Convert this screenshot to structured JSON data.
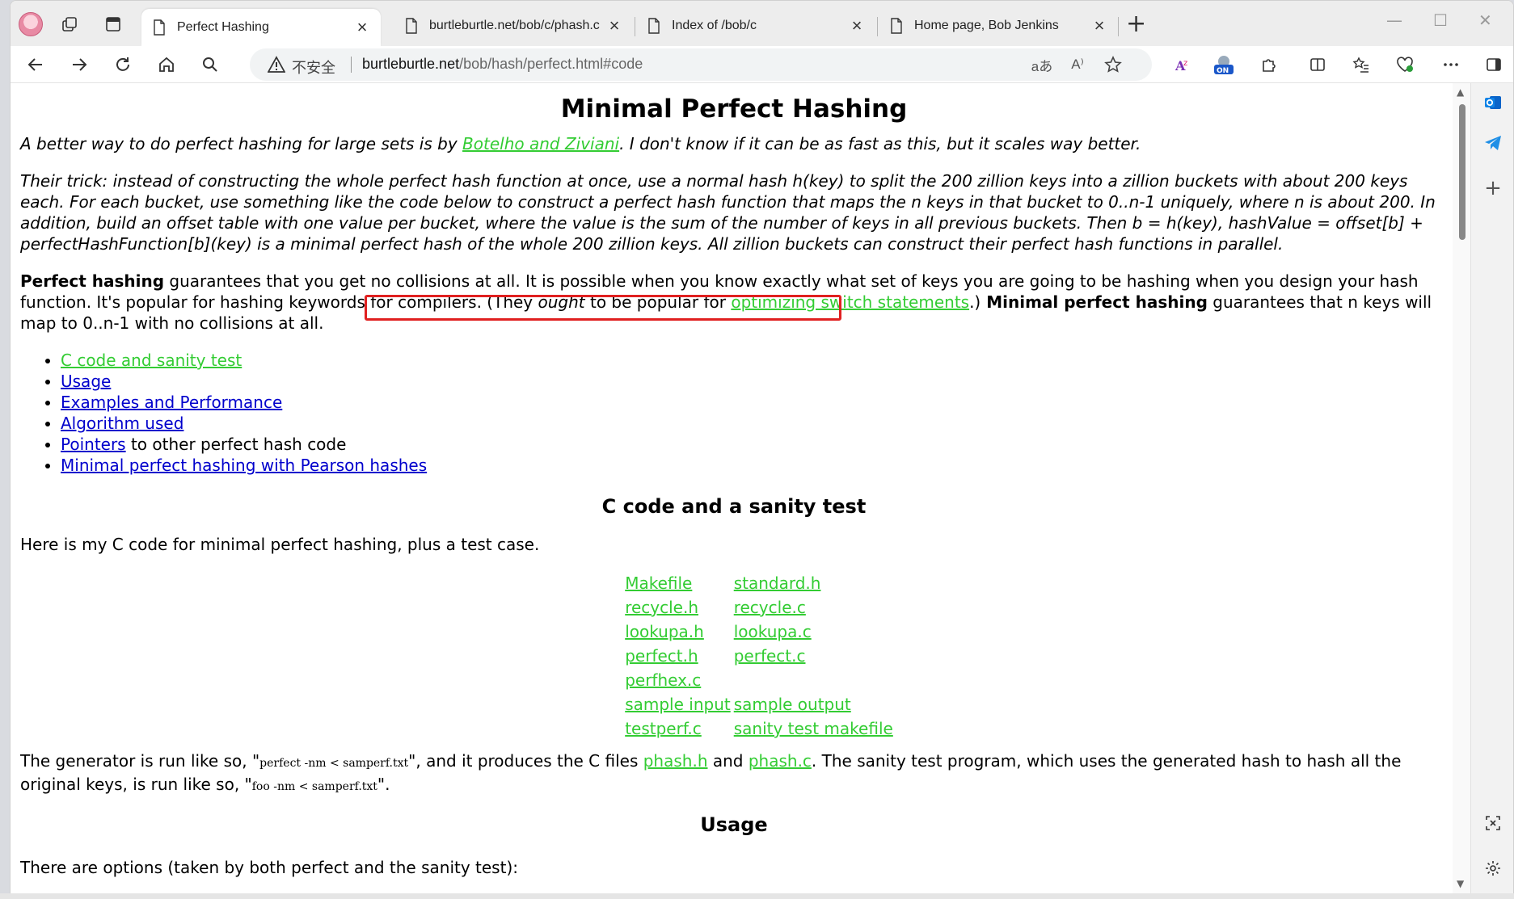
{
  "browser": {
    "tabs": [
      {
        "title": "Perfect Hashing",
        "active": true
      },
      {
        "title": "burtleburtle.net/bob/c/phash.c",
        "active": false
      },
      {
        "title": "Index of /bob/c",
        "active": false
      },
      {
        "title": "Home page, Bob Jenkins",
        "active": false
      }
    ],
    "tab_close": "×",
    "new_tab": "+",
    "address": {
      "insecure_label": "不安全",
      "url_host": "burtleburtle.net",
      "url_path": "/bob/hash/perfect.html#code"
    },
    "icons": {
      "badge_on": "ON"
    }
  },
  "page": {
    "title": "Minimal Perfect Hashing",
    "intro": {
      "before": "A better way to do perfect hashing for large sets is by ",
      "link": "Botelho and Ziviani",
      "after": ". I don't know if it can be as fast as this, but it scales way better."
    },
    "trick": "Their trick: instead of constructing the whole perfect hash function at once, use a normal hash h(key) to split the 200 zillion keys into a zillion buckets with about 200 keys each. For each bucket, use something like the code below to construct a perfect hash function that maps the n keys in that bucket to 0..n-1 uniquely, where n is about 200. In addition, build an offset table with one value per bucket, where the value is the sum of the number of keys in all previous buckets. Then b = h(key), hashValue = offset[b] + perfectHashFunction[b](key) is a minimal perfect hash of the whole 200 zillion keys. All zillion buckets can construct their perfect hash functions in parallel.",
    "definition": {
      "bold1": "Perfect hashing",
      "text1": " guarantees that you get no collisions at all. It is possible when you know exactly what set of keys you are going to be hashing when you design your hash function. It's popular for hashing keywords for compilers. ",
      "paren_open": "(They ",
      "ought": "ought",
      "mid": " to be popular for ",
      "link": "optimizing switch statements",
      "paren_close": ".)",
      "bold2": " Minimal perfect hashing",
      "text2": " guarantees that n keys will map to 0..n-1 with no collisions at all."
    },
    "toc": [
      {
        "link": "C code and sanity test",
        "suffix": "",
        "visited": true
      },
      {
        "link": "Usage",
        "suffix": "",
        "visited": false
      },
      {
        "link": "Examples and Performance",
        "suffix": "",
        "visited": false
      },
      {
        "link": "Algorithm used",
        "suffix": "",
        "visited": false
      },
      {
        "link": "Pointers",
        "suffix": " to other perfect hash code",
        "visited": false
      },
      {
        "link": "Minimal perfect hashing with Pearson hashes",
        "suffix": "",
        "visited": false
      }
    ],
    "section_code_title": "C code and a sanity test",
    "code_intro": "Here is my C code for minimal perfect hashing, plus a test case.",
    "files": [
      [
        "Makefile",
        "standard.h"
      ],
      [
        "recycle.h",
        "recycle.c"
      ],
      [
        "lookupa.h",
        "lookupa.c"
      ],
      [
        "perfect.h",
        "perfect.c"
      ],
      [
        "perfhex.c",
        ""
      ],
      [
        "sample input",
        "sample output"
      ],
      [
        "testperf.c",
        "sanity test makefile"
      ]
    ],
    "generator": {
      "t1": "The generator is run like so, \"",
      "cmd1": "perfect -nm < samperf.txt",
      "t2": "\", and it produces the C files ",
      "f1": "phash.h",
      "t3": " and ",
      "f2": "phash.c",
      "t4": ". The sanity test program, which uses the generated hash to hash all the original keys, is run like so, \"",
      "cmd2": "foo -nm < samperf.txt",
      "t5": "\"."
    },
    "section_usage_title": "Usage",
    "usage_intro": "There are options (taken by both perfect and the sanity test):"
  }
}
